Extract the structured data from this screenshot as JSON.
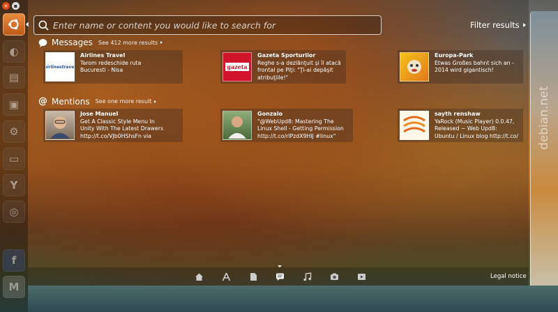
{
  "search": {
    "placeholder": "Enter name or content you would like to search for"
  },
  "filter": {
    "label": "Filter results"
  },
  "messages": {
    "title": "Messages",
    "more": "See 412 more results",
    "items": [
      {
        "title": "Airlines Travel",
        "body": "Tarom redeschide ruta\nBucuresti - Nisa",
        "thumb_text": "airlinestravel"
      },
      {
        "title": "Gazeta Sporturilor",
        "body": "Reghe s-a dezlănţuit şi îl atacă\nfrontal pe Piţi: \"Ţi-ai depăşit\natribuţiile!\"",
        "thumb_text": "gazeta"
      },
      {
        "title": "Europa-Park",
        "body": "Etwas Großes bahnt sich an -\n2014 wird gigantisch!",
        "thumb_text": ""
      }
    ]
  },
  "mentions": {
    "title": "Mentions",
    "more": "See one more result",
    "items": [
      {
        "title": "Jose Manuel",
        "body": "Get A Classic Style Menu In\nUnity With The Latest Drawers\nhttp://t.co/VJb0HShsFn via"
      },
      {
        "title": "Gonzalo",
        "body": "\"@WebUpd8: Mastering The\nLinux Shell - Getting Permission\nhttp://t.co/rlPzdX9HlJ #linux\""
      },
      {
        "title": "sayth renshaw",
        "body": "YaRock (Music Player) 0.0.47,\nReleased ~ Web Upd8:\nUbuntu / Linux blog http://t.co/"
      }
    ]
  },
  "footer": {
    "legal": "Legal notice"
  },
  "watermark": "debian.net",
  "launcher": {
    "letters": [
      "f",
      "M"
    ]
  },
  "colors": {
    "accent": "#dd4814",
    "gazeta_red": "#d0142c"
  }
}
